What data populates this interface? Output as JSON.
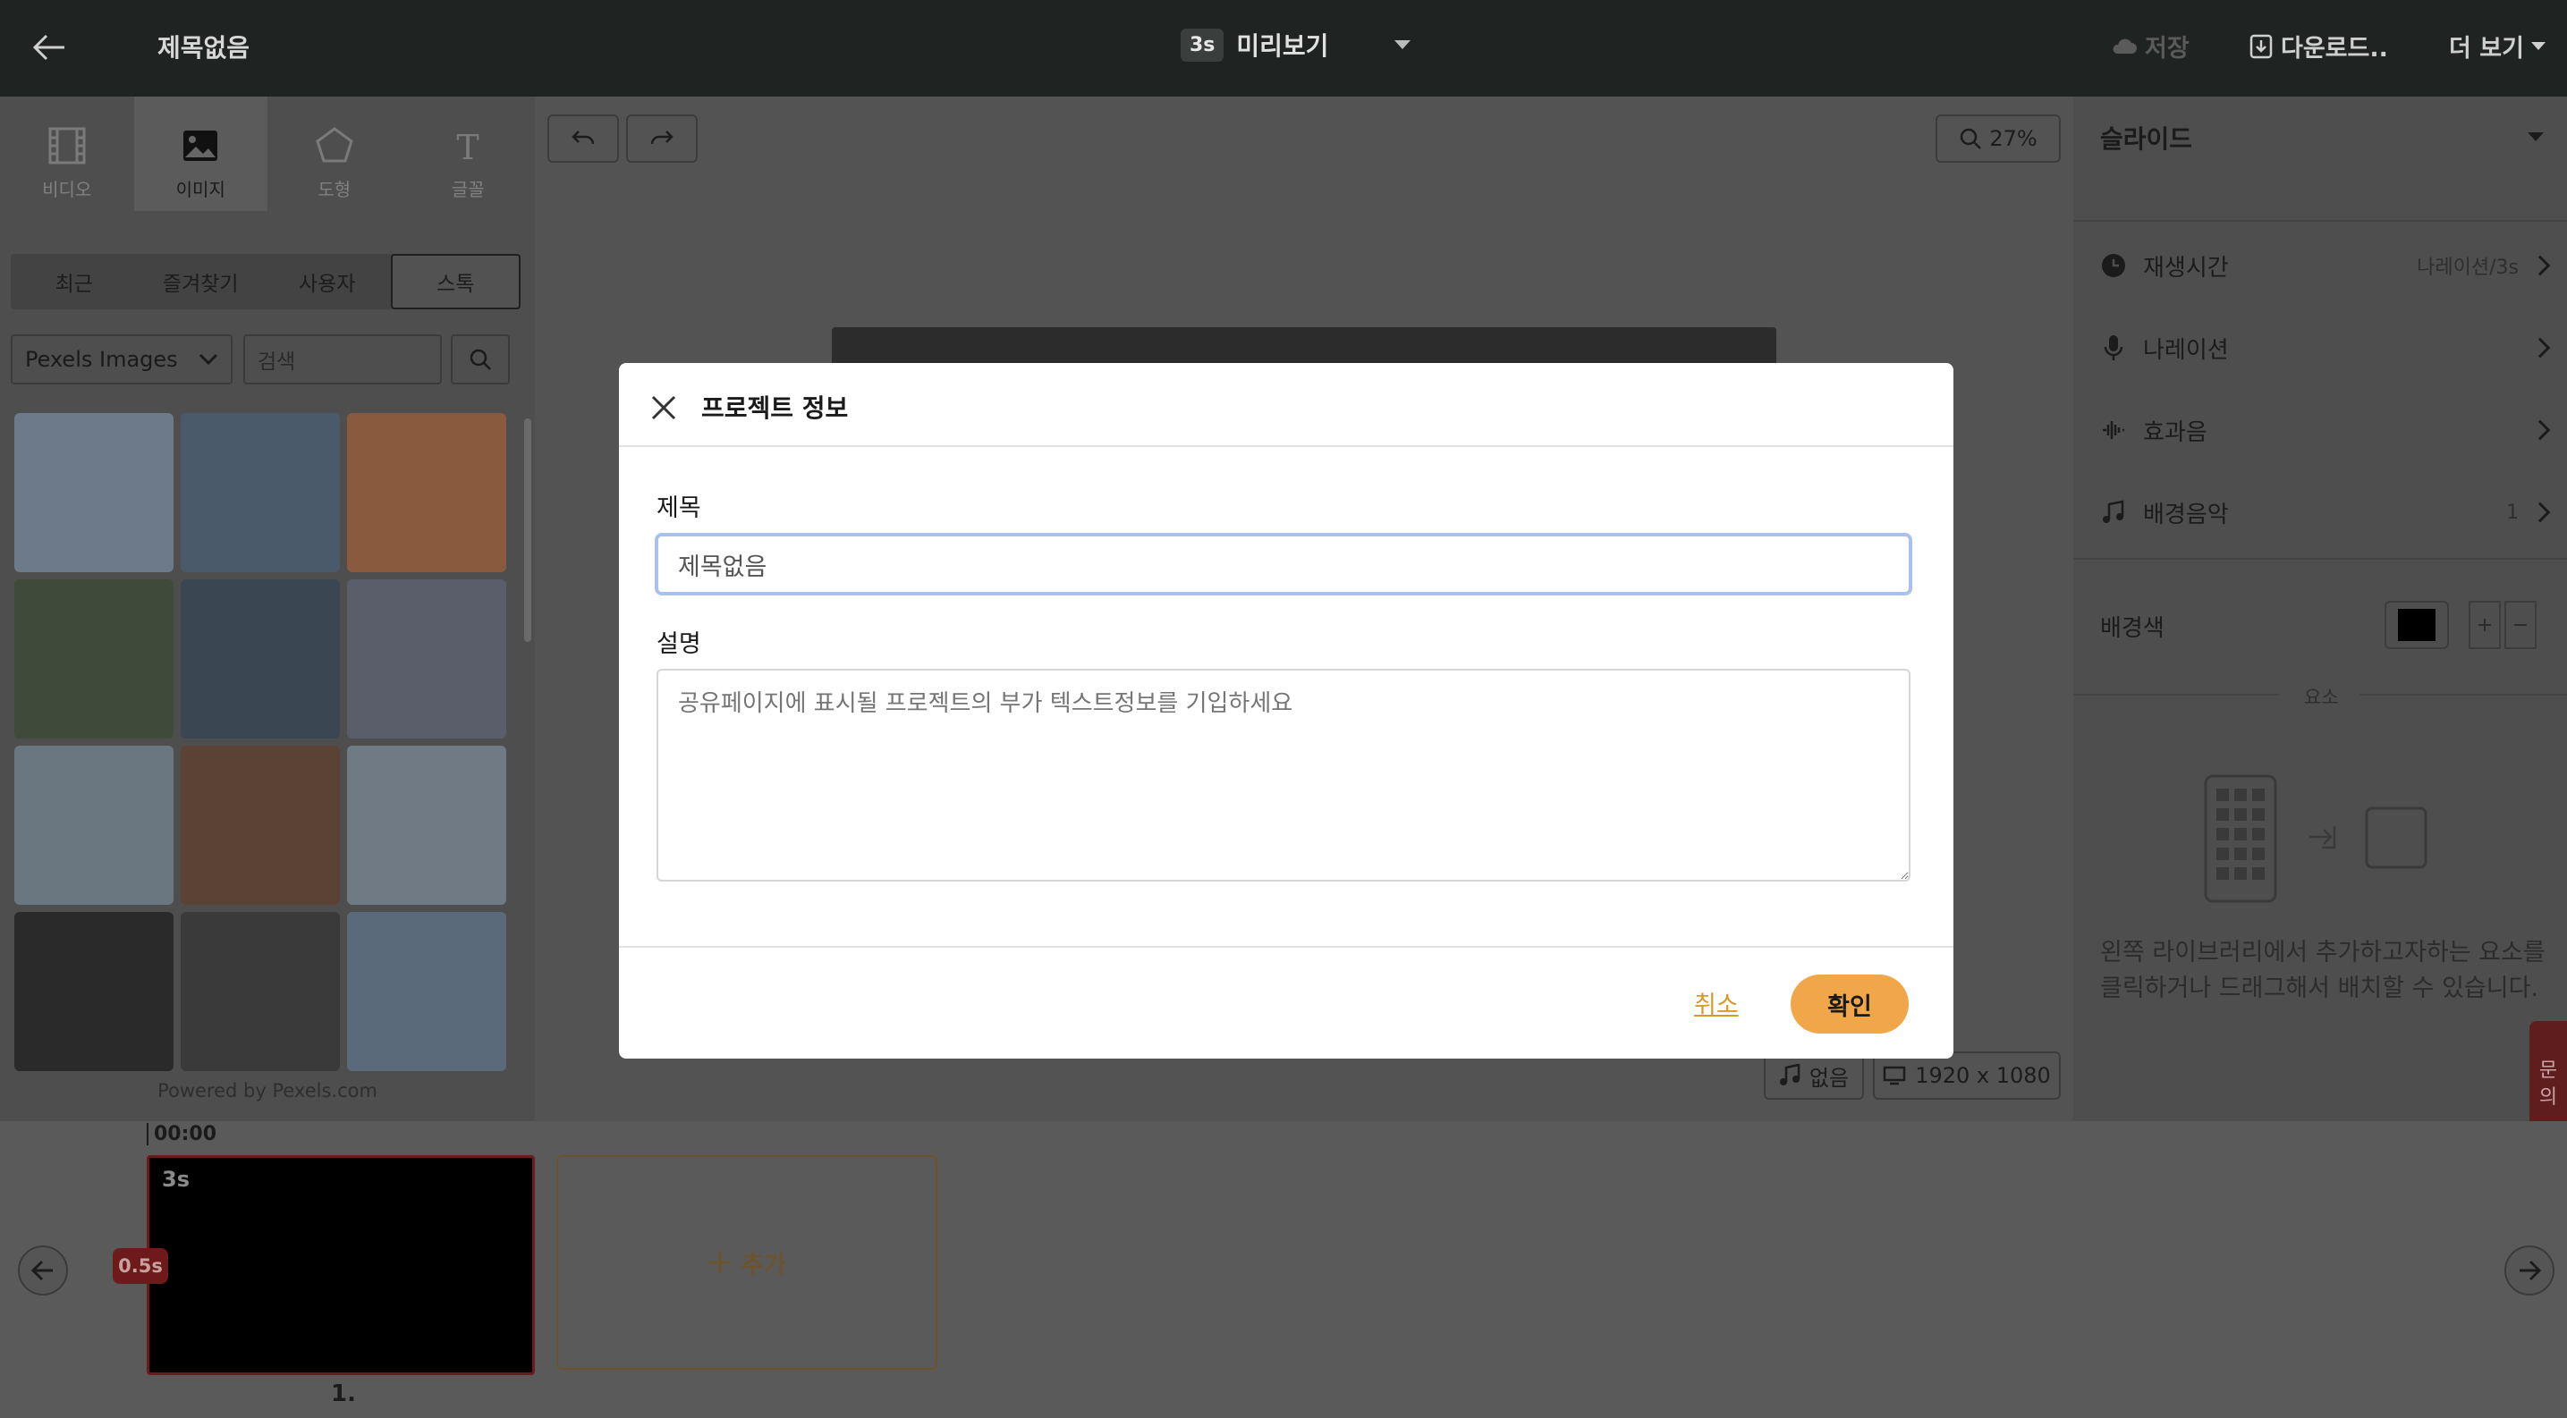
{
  "topbar": {
    "title": "제목없음",
    "preview_duration": "3s",
    "preview_label": "미리보기",
    "save_label": "저장",
    "download_label": "다운로드..",
    "more_label": "더 보기"
  },
  "media_tabs": [
    {
      "label": "비디오",
      "icon": "video-icon"
    },
    {
      "label": "이미지",
      "icon": "image-icon"
    },
    {
      "label": "도형",
      "icon": "shape-icon"
    },
    {
      "label": "글꼴",
      "icon": "text-icon"
    }
  ],
  "sub_tabs": [
    "최근",
    "즐겨찾기",
    "사용자",
    "스톡"
  ],
  "source_select": "Pexels Images",
  "search": {
    "placeholder": "검색"
  },
  "thumbnails_colors": [
    "#6c7a8a",
    "#4a5a6a",
    "#8a5a3e",
    "#3e4a3a",
    "#3a4652",
    "#5a5e6a",
    "#6a7680",
    "#5a4234",
    "#707a84",
    "#2a2a2a",
    "#3a3a3a",
    "#5a6a7a"
  ],
  "powered_by": "Powered by Pexels.com",
  "canvas": {
    "zoom": "27%",
    "audio_label": "없음",
    "resolution": "1920 x 1080"
  },
  "right_panel": {
    "title": "슬라이드",
    "rows": [
      {
        "label": "재생시간",
        "value": "나레이션/3s",
        "icon": "clock-icon"
      },
      {
        "label": "나레이션",
        "value": "",
        "icon": "mic-icon"
      },
      {
        "label": "효과음",
        "value": "",
        "icon": "sound-wave-icon"
      },
      {
        "label": "배경음악",
        "value": "1",
        "icon": "music-icon"
      }
    ],
    "bg_color_label": "배경색",
    "bg_color": "#000000",
    "plus": "+",
    "minus": "−",
    "elements_label": "요소",
    "hint": "왼쪽 라이브러리에서 추가하고자하는 요소를 클릭하거나 드래그해서 배치할 수 있습니다."
  },
  "side_tab": {
    "line1": "문",
    "line2": "의"
  },
  "timeline": {
    "time": "00:00",
    "clip_duration": "3s",
    "transition": "0.5s",
    "clip_number": "1.",
    "add_label": "추가"
  },
  "modal": {
    "title": "프로젝트 정보",
    "title_label": "제목",
    "title_value": "제목없음",
    "desc_label": "설명",
    "desc_placeholder": "공유페이지에 표시될 프로젝트의 부가 텍스트정보를 기입하세요",
    "cancel": "취소",
    "confirm": "확인"
  }
}
